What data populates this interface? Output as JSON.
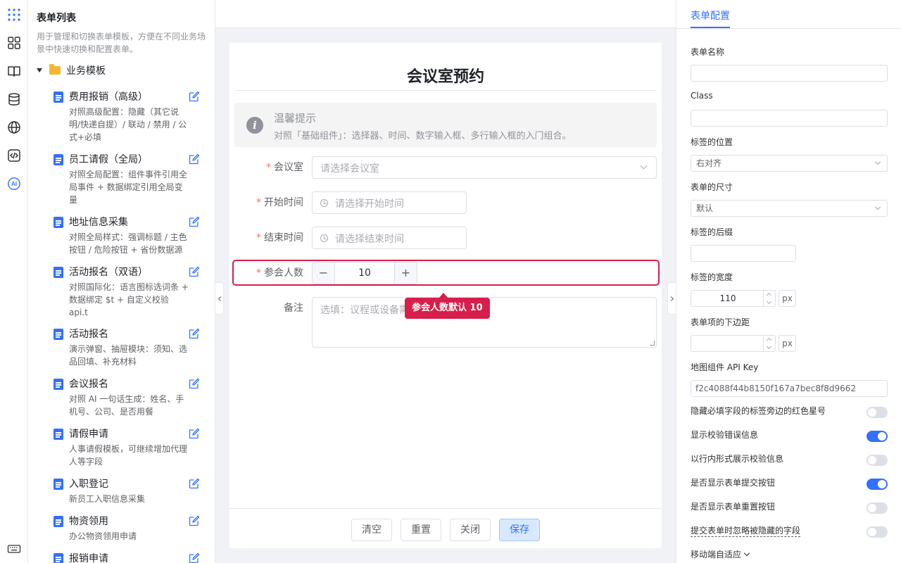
{
  "rail": {
    "icons": [
      "apps-grid-icon",
      "components-icon",
      "book-icon",
      "database-icon",
      "globe-icon",
      "code-icon",
      "ai-icon",
      "keyboard-icon"
    ],
    "ai_label": "AI",
    "accent": "#3370ff"
  },
  "sidebar": {
    "title": "表单列表",
    "description": "用于管理和切换表单模板，方便在不同业务场景中快速切换和配置表单。",
    "group_label": "业务模板",
    "items": [
      {
        "title": "费用报销（高级）",
        "desc": "对照高级配置：隐藏（其它说明/快递自提）/ 联动 / 禁用 / 公式+必填"
      },
      {
        "title": "员工请假（全局）",
        "desc": "对照全局配置：组件事件引用全局事件 + 数据绑定引用全局变量"
      },
      {
        "title": "地址信息采集",
        "desc": "对照全局样式：强调标题 / 主色按钮 / 危险按钮 + 省份数据源"
      },
      {
        "title": "活动报名（双语）",
        "desc": "对照国际化：语言图标选词条 + 数据绑定 $t + 自定义校验 api.t"
      },
      {
        "title": "活动报名",
        "desc": "演示弹窗、抽屉模块：须知、选品回填、补充材料"
      },
      {
        "title": "会议报名",
        "desc": "对照 AI 一句话生成：姓名、手机号、公司、是否用餐"
      },
      {
        "title": "请假申请",
        "desc": "人事请假模板，可继续增加代理人等字段"
      },
      {
        "title": "入职登记",
        "desc": "新员工入职信息采集"
      },
      {
        "title": "物资领用",
        "desc": "办公物资领用申请"
      },
      {
        "title": "报销申请",
        "desc": ""
      }
    ]
  },
  "form": {
    "title": "会议室预约",
    "tip": {
      "title": "温馨提示",
      "text": "对照「基础组件」：选择器、时间、数字输入框、多行输入框的入门组合。"
    },
    "required_mark": "*",
    "fields": {
      "room": {
        "label": "会议室",
        "placeholder": "请选择会议室"
      },
      "start": {
        "label": "开始时间",
        "placeholder": "请选择开始时间"
      },
      "end": {
        "label": "结束时间",
        "placeholder": "请选择结束时间"
      },
      "attendees": {
        "label": "参会人数",
        "value": "10",
        "minus": "−",
        "plus": "+"
      },
      "notes": {
        "label": "备注",
        "placeholder": "选填：议程或设备需求"
      }
    },
    "tooltip": "参会人数默认 10",
    "buttons": {
      "clear": "清空",
      "reset": "重置",
      "close": "关闭",
      "save": "保存"
    },
    "highlight_color": "#d81e4b"
  },
  "config": {
    "tab": "表单配置",
    "name_label": "表单名称",
    "name_value": "",
    "class_label": "Class",
    "class_value": "",
    "label_position_label": "标签的位置",
    "label_position_value": "右对齐",
    "size_label": "表单的尺寸",
    "size_value": "默认",
    "suffix_label": "标签的后缀",
    "suffix_value": "",
    "label_width_label": "标签的宽度",
    "label_width_value": "110",
    "label_width_unit": "px",
    "margin_label": "表单项的下边距",
    "margin_value": "",
    "margin_unit": "px",
    "api_key_label": "地图组件 API Key",
    "api_key_value": "f2c4088f44b8150f167a7bec8f8d9662",
    "switches": [
      {
        "label": "隐藏必填字段的标签旁边的红色星号",
        "on": false
      },
      {
        "label": "显示校验错误信息",
        "on": true
      },
      {
        "label": "以行内形式展示校验信息",
        "on": false
      },
      {
        "label": "是否显示表单提交按钮",
        "on": true
      },
      {
        "label": "是否显示表单重置按钮",
        "on": false
      },
      {
        "label": "提交表单时忽略被隐藏的字段",
        "on": false
      }
    ],
    "mobile_label": "移动端自适应"
  }
}
